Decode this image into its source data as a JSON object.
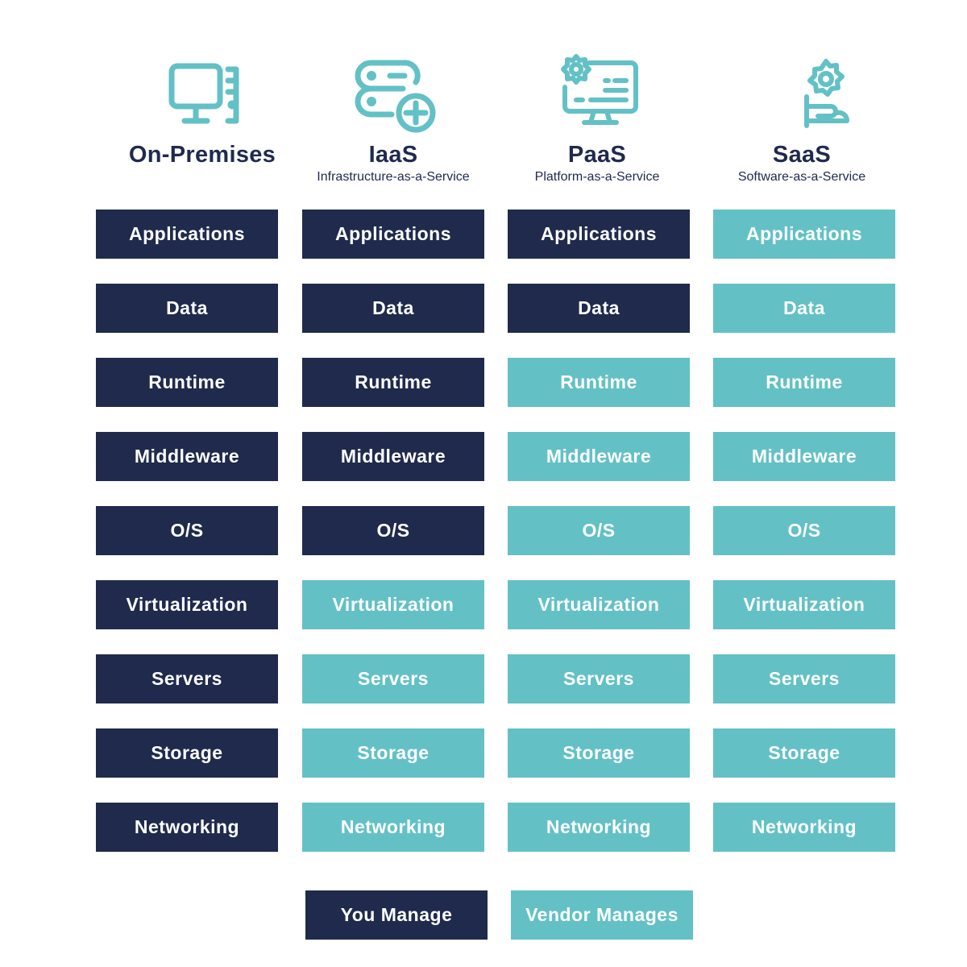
{
  "colors": {
    "you_manage": "#1f2a4d",
    "vendor_manages": "#63c1c6",
    "icon": "#63c1c6",
    "heading": "#1f2a4d"
  },
  "columns": [
    {
      "title": "On-Premises",
      "subtitle": "",
      "icon": "desktop-computer-icon",
      "cells": [
        {
          "label": "Applications",
          "managed_by": "you"
        },
        {
          "label": "Data",
          "managed_by": "you"
        },
        {
          "label": "Runtime",
          "managed_by": "you"
        },
        {
          "label": "Middleware",
          "managed_by": "you"
        },
        {
          "label": "O/S",
          "managed_by": "you"
        },
        {
          "label": "Virtualization",
          "managed_by": "you"
        },
        {
          "label": "Servers",
          "managed_by": "you"
        },
        {
          "label": "Storage",
          "managed_by": "you"
        },
        {
          "label": "Networking",
          "managed_by": "you"
        }
      ]
    },
    {
      "title": "IaaS",
      "subtitle": "Infrastructure-as-a-Service",
      "icon": "server-add-icon",
      "cells": [
        {
          "label": "Applications",
          "managed_by": "you"
        },
        {
          "label": "Data",
          "managed_by": "you"
        },
        {
          "label": "Runtime",
          "managed_by": "you"
        },
        {
          "label": "Middleware",
          "managed_by": "you"
        },
        {
          "label": "O/S",
          "managed_by": "you"
        },
        {
          "label": "Virtualization",
          "managed_by": "vendor"
        },
        {
          "label": "Servers",
          "managed_by": "vendor"
        },
        {
          "label": "Storage",
          "managed_by": "vendor"
        },
        {
          "label": "Networking",
          "managed_by": "vendor"
        }
      ]
    },
    {
      "title": "PaaS",
      "subtitle": "Platform-as-a-Service",
      "icon": "monitor-gear-icon",
      "cells": [
        {
          "label": "Applications",
          "managed_by": "you"
        },
        {
          "label": "Data",
          "managed_by": "you"
        },
        {
          "label": "Runtime",
          "managed_by": "vendor"
        },
        {
          "label": "Middleware",
          "managed_by": "vendor"
        },
        {
          "label": "O/S",
          "managed_by": "vendor"
        },
        {
          "label": "Virtualization",
          "managed_by": "vendor"
        },
        {
          "label": "Servers",
          "managed_by": "vendor"
        },
        {
          "label": "Storage",
          "managed_by": "vendor"
        },
        {
          "label": "Networking",
          "managed_by": "vendor"
        }
      ]
    },
    {
      "title": "SaaS",
      "subtitle": "Software-as-a-Service",
      "icon": "hand-gear-icon",
      "cells": [
        {
          "label": "Applications",
          "managed_by": "vendor"
        },
        {
          "label": "Data",
          "managed_by": "vendor"
        },
        {
          "label": "Runtime",
          "managed_by": "vendor"
        },
        {
          "label": "Middleware",
          "managed_by": "vendor"
        },
        {
          "label": "O/S",
          "managed_by": "vendor"
        },
        {
          "label": "Virtualization",
          "managed_by": "vendor"
        },
        {
          "label": "Servers",
          "managed_by": "vendor"
        },
        {
          "label": "Storage",
          "managed_by": "vendor"
        },
        {
          "label": "Networking",
          "managed_by": "vendor"
        }
      ]
    }
  ],
  "legend": {
    "you_manage": "You Manage",
    "vendor_manages": "Vendor Manages"
  }
}
